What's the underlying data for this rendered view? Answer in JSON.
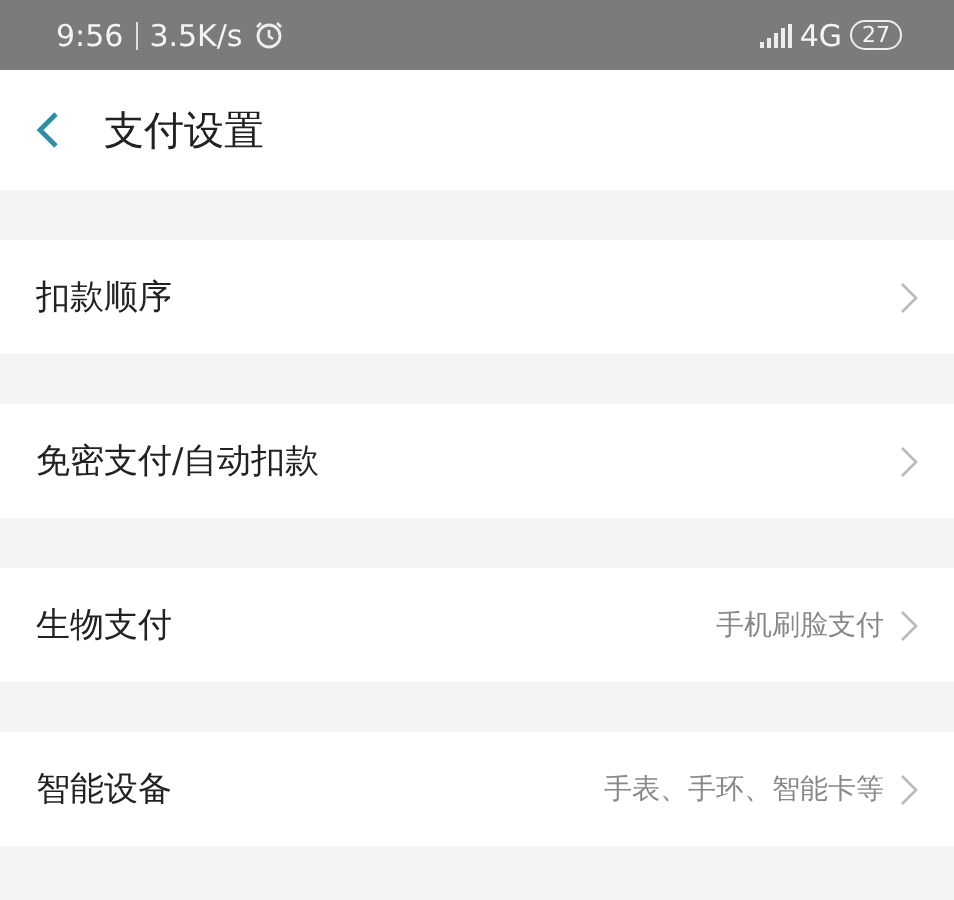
{
  "status_bar": {
    "time": "9:56",
    "speed": "3.5K/s",
    "network": "4G",
    "battery": "27"
  },
  "header": {
    "title": "支付设置"
  },
  "items": [
    {
      "label": "扣款顺序"
    },
    {
      "label": "免密支付/自动扣款"
    },
    {
      "label": "生物支付",
      "value": "手机刷脸支付"
    },
    {
      "label": "智能设备",
      "value": "手表、手环、智能卡等"
    }
  ]
}
